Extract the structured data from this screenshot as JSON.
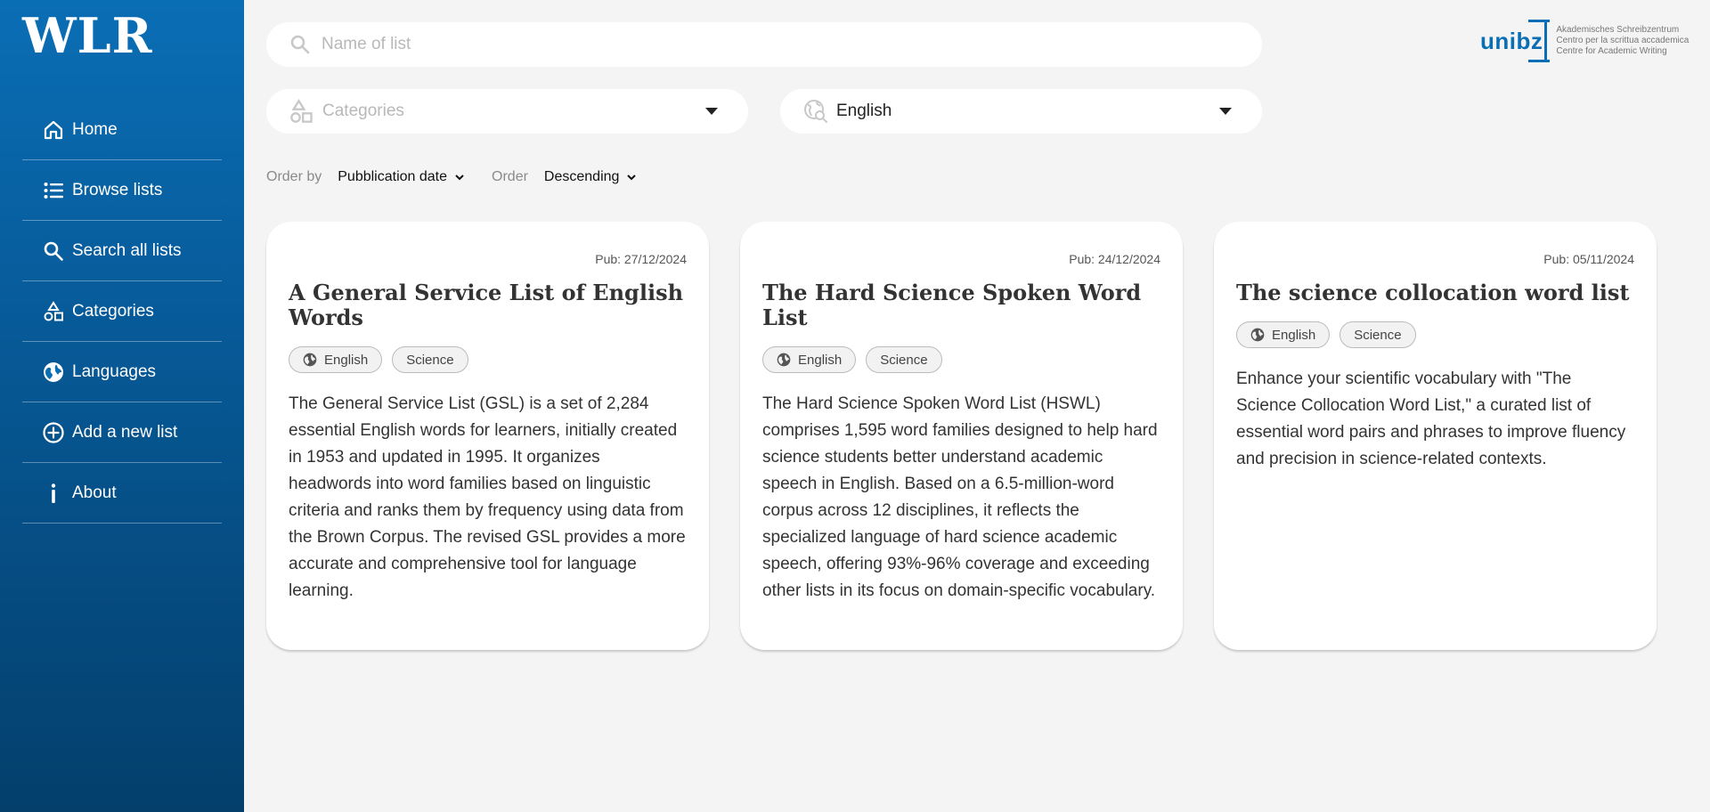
{
  "sidebar": {
    "logo": "WLR",
    "items": [
      {
        "label": "Home",
        "icon": "home-icon"
      },
      {
        "label": "Browse lists",
        "icon": "list-icon"
      },
      {
        "label": "Search all lists",
        "icon": "search-icon"
      },
      {
        "label": "Categories",
        "icon": "shapes-icon"
      },
      {
        "label": "Languages",
        "icon": "globe-icon"
      },
      {
        "label": "Add a new list",
        "icon": "plus-circle-icon"
      },
      {
        "label": "About",
        "icon": "info-icon"
      }
    ]
  },
  "search": {
    "placeholder": "Name of list",
    "value": ""
  },
  "filters": {
    "categories_placeholder": "Categories",
    "language_value": "English"
  },
  "order": {
    "order_by_label": "Order by",
    "order_by_value": "Pubblication date",
    "order_label": "Order",
    "order_value": "Descending"
  },
  "brand": {
    "name": "unibz",
    "line1": "Akademisches Schreibzentrum",
    "line2": "Centro per la scrittua accademica",
    "line3": "Centre for Academic Writing"
  },
  "cards": [
    {
      "pub": "Pub: 27/12/2024",
      "title": "A General Service List of English Words",
      "tags": [
        "English",
        "Science"
      ],
      "description": "The General Service List (GSL) is a set of 2,284 essential English words for learners, initially created in 1953 and updated in 1995. It organizes headwords into word families based on linguistic criteria and ranks them by frequency using data from the Brown Corpus. The revised GSL provides a more accurate and comprehensive tool for language learning."
    },
    {
      "pub": "Pub: 24/12/2024",
      "title": "The Hard Science Spoken Word List",
      "tags": [
        "English",
        "Science"
      ],
      "description": "The Hard Science Spoken Word List (HSWL) comprises 1,595 word families designed to help hard science students better understand academic speech in English. Based on a 6.5-million-word corpus across 12 disciplines, it reflects the specialized language of hard science academic speech, offering 93%-96% coverage and exceeding other lists in its focus on domain-specific vocabulary."
    },
    {
      "pub": "Pub: 05/11/2024",
      "title": "The science collocation word list",
      "tags": [
        "English",
        "Science"
      ],
      "description": "Enhance your scientific vocabulary with \"The Science Collocation Word List,\" a curated list of essential word pairs and phrases to improve fluency and precision in science-related contexts."
    }
  ],
  "colors": {
    "sidebar_top": "#0a6eb5",
    "sidebar_bottom": "#043f6c",
    "background": "#f4f4f4"
  }
}
